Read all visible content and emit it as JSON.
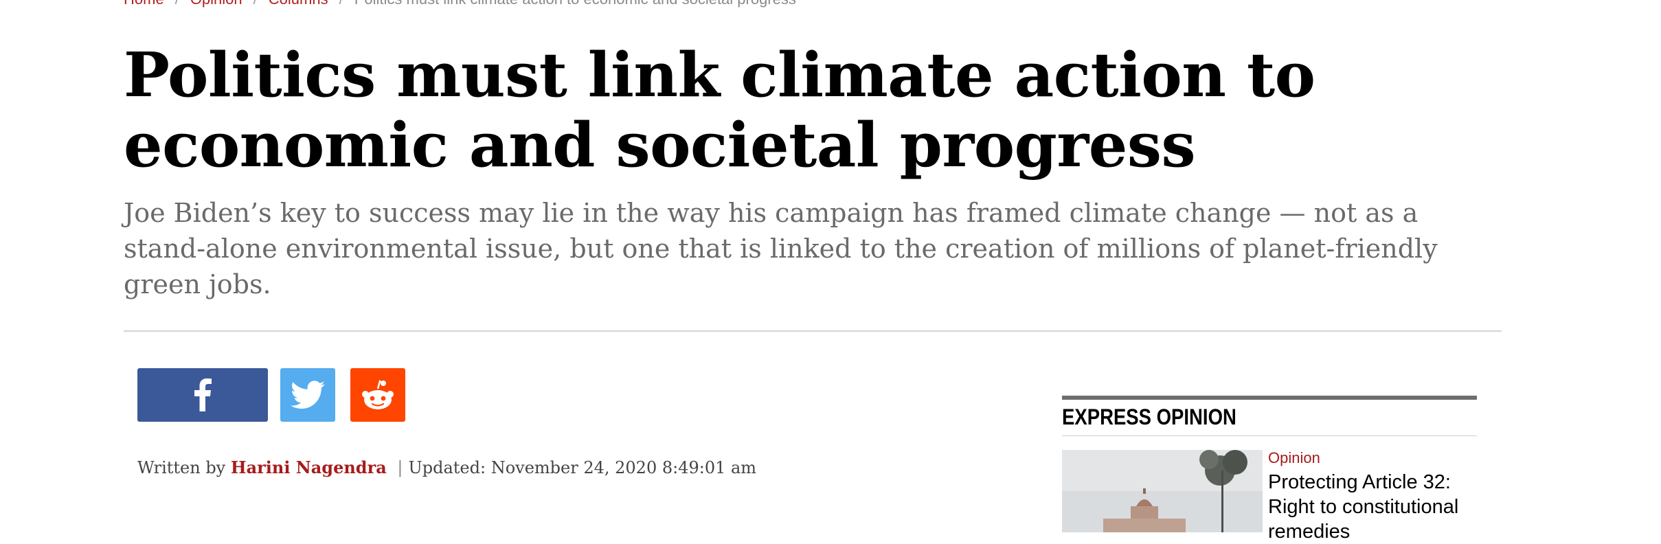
{
  "breadcrumb": {
    "items": [
      "Home",
      "Opinion",
      "Columns"
    ],
    "separator": "/",
    "current": "Politics must link climate action to economic and societal progress"
  },
  "article": {
    "headline": "Politics must link climate action to economic and societal progress",
    "standfirst": "Joe Biden’s key to success may lie in the way his campaign has framed climate change — not as a stand-alone environmental issue, but one that is linked to the creation of millions of planet-friendly green jobs.",
    "byline": {
      "written_by_label": "Written by",
      "author": "Harini Nagendra",
      "separator": "|",
      "updated_label": "Updated:",
      "updated_value": "November 24, 2020 8:49:01 am"
    }
  },
  "share": {
    "buttons": [
      {
        "network": "facebook",
        "icon": "facebook-icon",
        "color": "#3b5998"
      },
      {
        "network": "twitter",
        "icon": "twitter-icon",
        "color": "#55acee"
      },
      {
        "network": "reddit",
        "icon": "reddit-icon",
        "color": "#ff4500"
      }
    ]
  },
  "sidebar": {
    "title": "EXPRESS OPINION",
    "cards": [
      {
        "category": "Opinion",
        "title": "Protecting Article 32: Right to constitutional remedies",
        "thumbnail_icon": "supreme-court-photo"
      }
    ]
  },
  "colors": {
    "accent_red": "#a51c1c",
    "standfirst_gray": "#6a6a6a"
  }
}
